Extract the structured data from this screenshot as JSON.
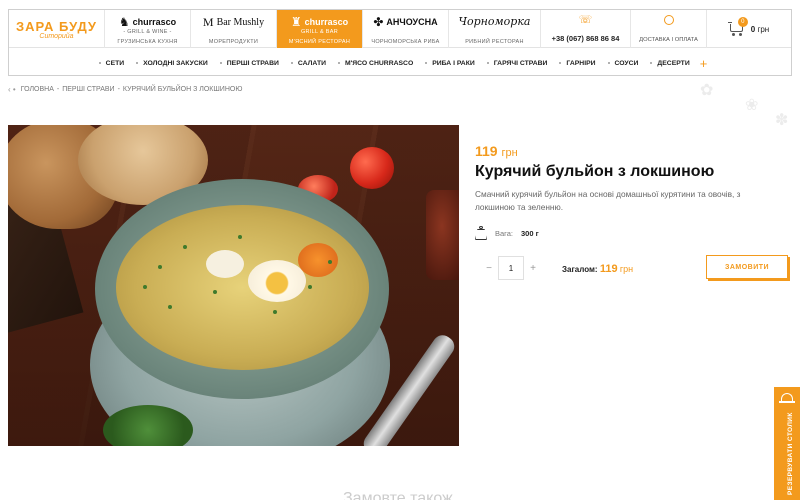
{
  "brand": {
    "name": "ЗАРА БУДУ",
    "tagline": "Ситорийа"
  },
  "restaurants": [
    {
      "logo": "churrasco",
      "logo_sub": "- Grill & Wine -",
      "caption": "ГРУЗИНСЬКА КУХНЯ",
      "active": false
    },
    {
      "logo": "Bar Mushly",
      "logo_sub": "",
      "caption": "МОРЕПРОДУКТИ",
      "active": false
    },
    {
      "logo": "churrasco",
      "logo_sub": "Grill & Bar",
      "caption": "М'ЯСНИЙ РЕСТОРАН",
      "active": true
    },
    {
      "logo": "АНЧОУСНА",
      "logo_sub": "",
      "caption": "ЧОРНОМОРСЬКА РИБА",
      "active": false
    },
    {
      "logo": "Чорноморка",
      "logo_sub": "",
      "caption": "РИБНИЙ РЕСТОРАН",
      "active": false
    }
  ],
  "contact": {
    "phone": "+38 (067) 868 86 84",
    "delivery_label": "ДОСТАВКА І ОПЛАТА"
  },
  "cart": {
    "count": "0",
    "total": "0",
    "currency": "грн"
  },
  "nav": [
    "СЕТИ",
    "ХОЛОДНІ ЗАКУСКИ",
    "ПЕРШІ СТРАВИ",
    "САЛАТИ",
    "М'ЯСО CHURRASCO",
    "РИБА І РАКИ",
    "ГАРЯЧІ СТРАВИ",
    "ГАРНІРИ",
    "СОУСИ",
    "ДЕСЕРТИ"
  ],
  "nav_more": "+",
  "breadcrumb": {
    "back": "‹ •",
    "items": [
      "ГОЛОВНА",
      "ПЕРШІ СТРАВИ",
      "КУРЯЧИЙ БУЛЬЙОН З ЛОКШИНОЮ"
    ],
    "separator": "-"
  },
  "product": {
    "price": "119",
    "currency": "грн",
    "title": "Курячий бульйон з локшиною",
    "description": "Смачний курячий бульйон на основі домашньої курятини та овочів, з локшиною та зеленню.",
    "weight_label": "Вага:",
    "weight_value": "300 г",
    "quantity": "1",
    "qty_minus": "−",
    "qty_plus": "+",
    "total_label": "Загалом:",
    "total_amount": "119",
    "total_currency": "грн",
    "order_label": "ЗАМОВИТИ"
  },
  "side_tab": {
    "label": "РЕЗЕРВУВАТИ СТОЛИК"
  },
  "bottom_heading": {
    "text": "Замовте також",
    "accent": "також"
  },
  "colors": {
    "accent": "#f39a1d"
  }
}
